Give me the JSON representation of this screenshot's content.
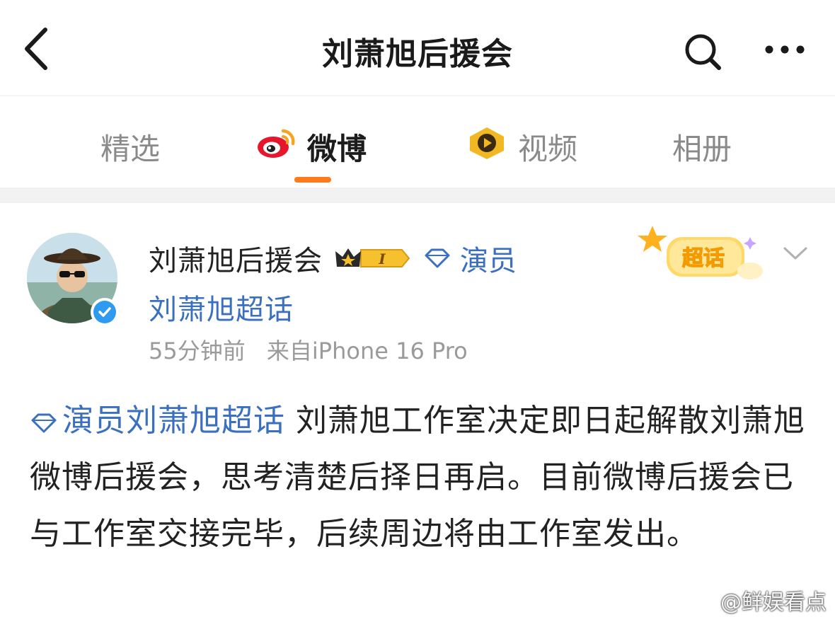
{
  "header": {
    "title": "刘萧旭后援会",
    "back_icon": "chevron-left-icon",
    "search_icon": "search-icon",
    "more_icon": "more-dots-icon"
  },
  "tabs": [
    {
      "label": "精选",
      "active": false
    },
    {
      "label": "微博",
      "active": true,
      "icon": "weibo-logo-icon"
    },
    {
      "label": "视频",
      "active": false,
      "icon": "video-play-icon"
    },
    {
      "label": "相册",
      "active": false
    }
  ],
  "accent_color": "#ff7a1a",
  "link_color": "#3b6fbf",
  "post": {
    "author": "刘萧旭后援会",
    "level_badge": "I",
    "tag": "演员",
    "topic": "刘萧旭超话",
    "timestamp": "55分钟前",
    "source": "来自iPhone 16 Pro",
    "sticker_text": "超话",
    "body_topic": "演员刘萧旭超话",
    "body_text": "刘萧旭工作室决定即日起解散刘萧旭微博后援会，思考清楚后择日再启。目前微博后援会已与工作室交接完毕，后续周边将由工作室发出。"
  },
  "watermark": "@鲜娱看点"
}
